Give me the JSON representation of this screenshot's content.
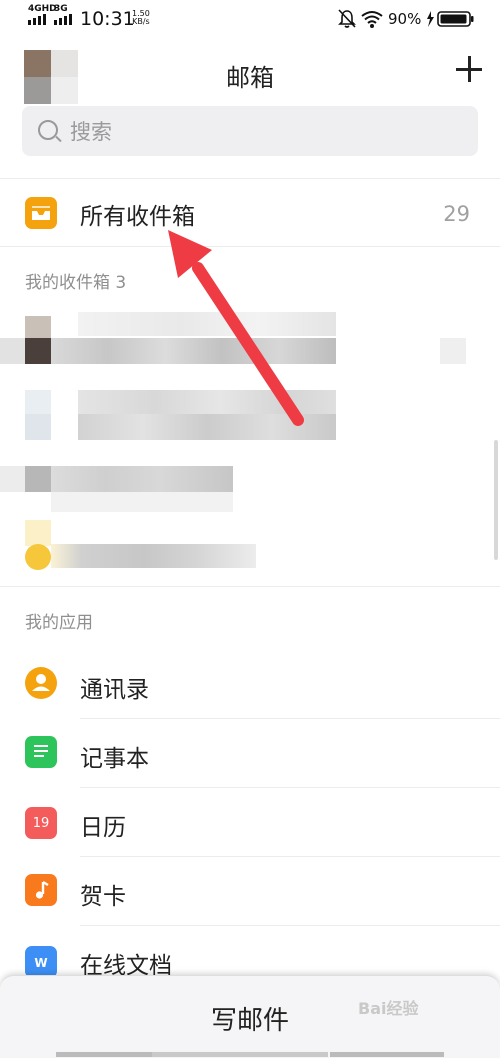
{
  "status": {
    "net1": "4GHD",
    "net2": "3G",
    "time": "10:31",
    "speed_value": "1.50",
    "speed_unit": "KB/s",
    "battery": "90%"
  },
  "header": {
    "title": "邮箱"
  },
  "search": {
    "placeholder": "搜索"
  },
  "all_inbox": {
    "label": "所有收件箱",
    "count": "29"
  },
  "inbox_section": {
    "title": "我的收件箱 3"
  },
  "apps_section": {
    "title": "我的应用",
    "items": [
      {
        "label": "通讯录",
        "icon": "contacts-icon",
        "color": "#f5a20f"
      },
      {
        "label": "记事本",
        "icon": "notebook-icon",
        "color": "#2dc45c"
      },
      {
        "label": "日历",
        "icon": "calendar-icon",
        "color": "#f45b5b",
        "icon_text": "19"
      },
      {
        "label": "贺卡",
        "icon": "greeting-card-icon",
        "color": "#f87a1d"
      },
      {
        "label": "在线文档",
        "icon": "document-icon",
        "color": "#3d8ff5",
        "icon_text": "W"
      }
    ]
  },
  "compose": {
    "label": "写邮件"
  },
  "watermark": {
    "text": "Bai经验"
  },
  "colors": {
    "accent_arrow": "#ee3b44",
    "inbox_icon": "#f5a20f"
  }
}
